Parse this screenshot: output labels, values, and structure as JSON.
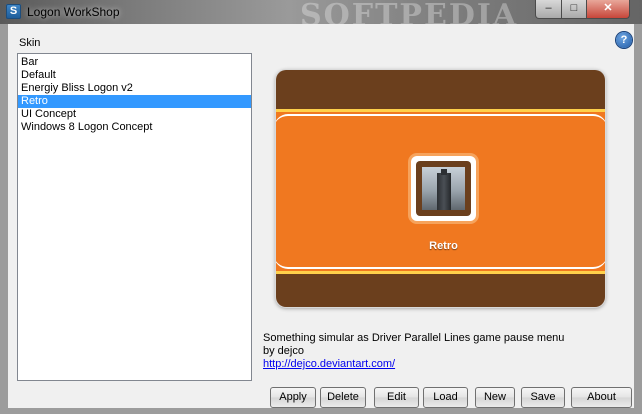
{
  "window": {
    "title": "Logon WorkShop",
    "icon_letter": "S",
    "watermark": "SOFTPEDIA",
    "controls": {
      "minimize": "–",
      "maximize": "□",
      "close": "✕"
    }
  },
  "skin": {
    "label": "Skin",
    "items": [
      {
        "label": "Bar"
      },
      {
        "label": "Default"
      },
      {
        "label": "Energiy Bliss Logon v2"
      },
      {
        "label": "Retro"
      },
      {
        "label": "UI Concept"
      },
      {
        "label": "Windows 8 Logon Concept"
      }
    ],
    "selected_index": 3
  },
  "help": {
    "label": "?"
  },
  "preview": {
    "caption": "Retro",
    "colors": {
      "brown": "#6b3f1d",
      "orange": "#f07820",
      "stripe": "#ffd04a"
    }
  },
  "description": {
    "line1": "Something simular as Driver Parallel Lines game pause menu",
    "line2": "by dejco",
    "link": "http://dejco.deviantart.com/"
  },
  "buttons": {
    "apply": "Apply",
    "delete": "Delete",
    "edit": "Edit",
    "load": "Load",
    "new": "New",
    "save": "Save",
    "about": "About"
  },
  "colors": {
    "selection": "#3399ff",
    "link": "#0000ee"
  }
}
